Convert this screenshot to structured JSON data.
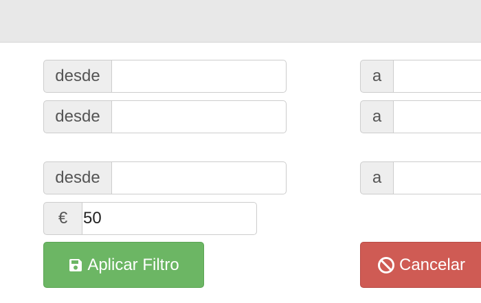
{
  "filters": {
    "row1": {
      "from_label": "desde",
      "from_value": "",
      "to_label": "a",
      "to_value": ""
    },
    "row2": {
      "from_label": "desde",
      "from_value": "",
      "to_label": "a",
      "to_value": ""
    },
    "row3": {
      "from_label": "desde",
      "from_value": "",
      "to_label": "a",
      "to_value": ""
    },
    "price": {
      "currency_symbol": "€",
      "value": "50"
    }
  },
  "actions": {
    "apply_label": "Aplicar Filtro",
    "apply_icon": "floppy-disk-icon",
    "cancel_label": "Cancelar",
    "cancel_icon": "ban-icon"
  },
  "colors": {
    "apply": "#6cb664",
    "cancel": "#cf5b54",
    "addon_bg": "#eeeeee",
    "topbar_bg": "#e8e8e8"
  }
}
